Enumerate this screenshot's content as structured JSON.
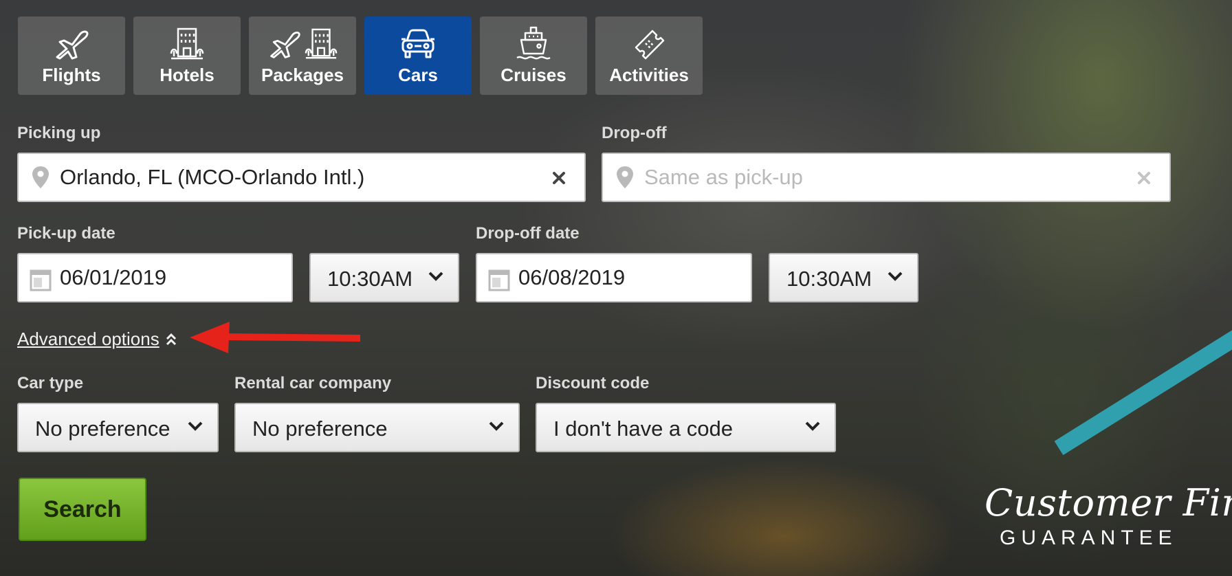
{
  "tabs": [
    {
      "label": "Flights",
      "icon": "plane-icon",
      "active": false
    },
    {
      "label": "Hotels",
      "icon": "hotel-icon",
      "active": false
    },
    {
      "label": "Packages",
      "icon": "package-icon",
      "active": false
    },
    {
      "label": "Cars",
      "icon": "car-icon",
      "active": true
    },
    {
      "label": "Cruises",
      "icon": "cruise-ship-icon",
      "active": false
    },
    {
      "label": "Activities",
      "icon": "ticket-icon",
      "active": false
    }
  ],
  "pickup": {
    "label": "Picking up",
    "value": "Orlando, FL (MCO-Orlando Intl.)"
  },
  "dropoff": {
    "label": "Drop-off",
    "placeholder": "Same as pick-up"
  },
  "pickup_date": {
    "label": "Pick-up date",
    "date": "06/01/2019",
    "time": "10:30AM"
  },
  "dropoff_date": {
    "label": "Drop-off date",
    "date": "06/08/2019",
    "time": "10:30AM"
  },
  "advanced": {
    "label": "Advanced options"
  },
  "car_type": {
    "label": "Car type",
    "value": "No preference"
  },
  "rental_company": {
    "label": "Rental car company",
    "value": "No preference"
  },
  "discount": {
    "label": "Discount code",
    "value": "I don't have a code"
  },
  "search": {
    "label": "Search"
  },
  "guarantee": {
    "line1": "Customer First",
    "line2": "GUARANTEE"
  },
  "colors": {
    "active_tab": "#0b4a9c",
    "search_button": "#7ab52d",
    "annotation_arrow": "#e5231b"
  }
}
